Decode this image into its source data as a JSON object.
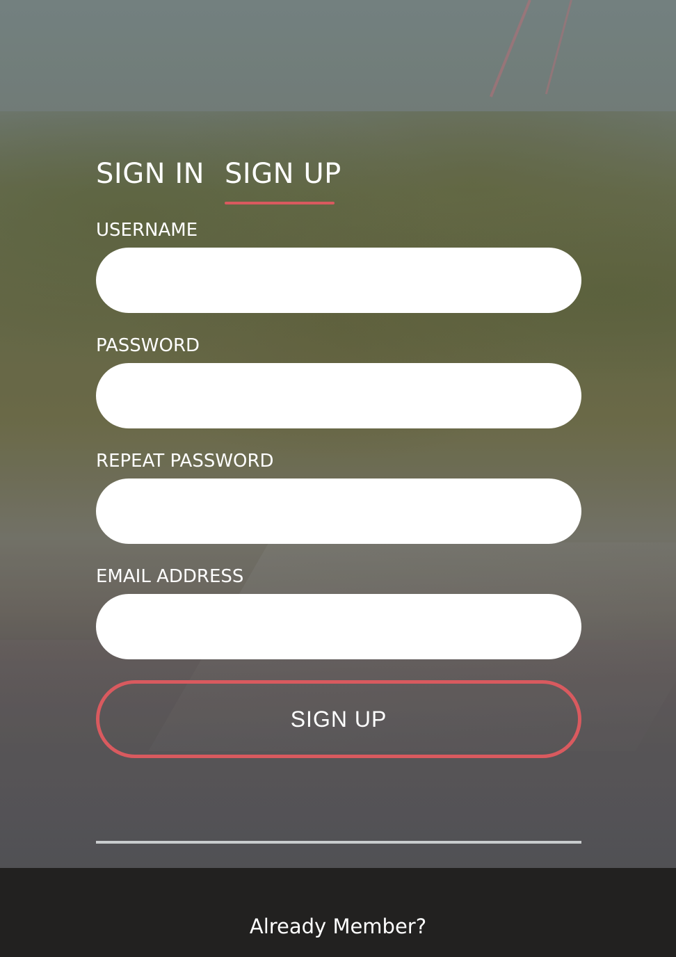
{
  "tabs": [
    {
      "label": "SIGN IN",
      "active": false
    },
    {
      "label": "SIGN UP",
      "active": true
    }
  ],
  "form": {
    "username": {
      "label": "USERNAME",
      "value": "",
      "placeholder": ""
    },
    "password": {
      "label": "PASSWORD",
      "value": "",
      "placeholder": ""
    },
    "repeat_password": {
      "label": "REPEAT PASSWORD",
      "value": "",
      "placeholder": ""
    },
    "email": {
      "label": "EMAIL ADDRESS",
      "value": "",
      "placeholder": ""
    },
    "submit_label": "SIGN UP"
  },
  "footer": {
    "link_label": "Already Member?"
  },
  "colors": {
    "accent": "#d95a5f",
    "footer_bg": "#222120",
    "field_bg": "#ffffff",
    "divider": "#c9ccce"
  }
}
